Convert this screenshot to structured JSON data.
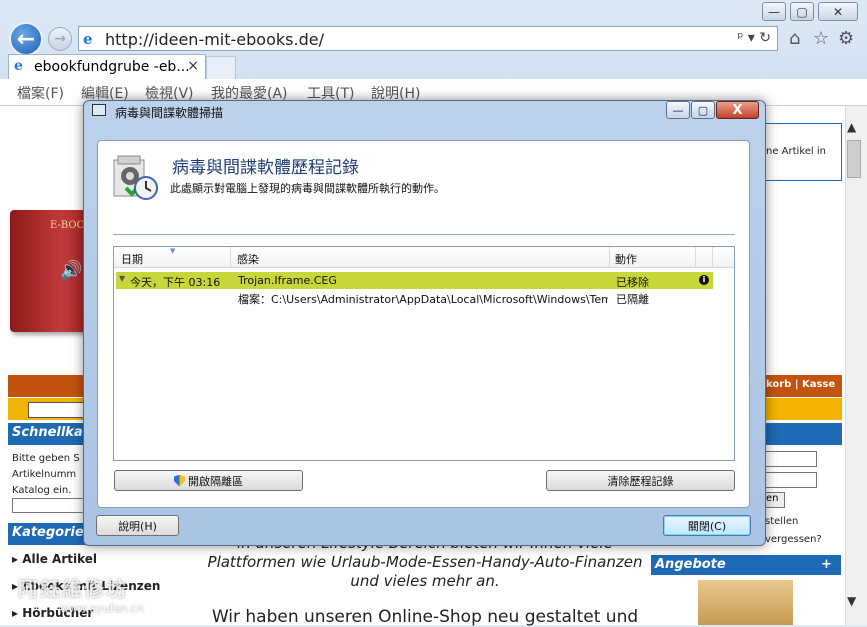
{
  "browser": {
    "url": "http://ideen-mit-ebooks.de/",
    "tab_title": "ebookfundgrube -eb...",
    "tab_close": "×",
    "menu": [
      "檔案(F)",
      "編輯(E)",
      "檢視(V)",
      "我的最愛(A)",
      "工具(T)",
      "說明(H)"
    ],
    "address_tools": "ᵖ ▾ ↻"
  },
  "page": {
    "schnellkauf": "Schnellkau",
    "schnell_text": [
      "Bitte geben S",
      "Artikelnumm",
      "Katalog ein."
    ],
    "kategorien": "Kategorien",
    "categories": [
      "Alle Artikel",
      "Ebooks mit Lizenzen",
      "Hörbücher"
    ],
    "right_top_text": "ne Artikel in",
    "right_orange": "korb | Kasse",
    "right_btn": "en",
    "right_stellen": "stellen",
    "right_vergessen": "vergessen?",
    "angebote": "Angebote",
    "angebote_plus": "+",
    "center_line1": "in unseren Lifestyle Bereich bieten wir Ihnen viele",
    "center_line2": "Plattformen wie Urlaub-Mode-Essen-Handy-Auto-Finanzen",
    "center_line3": "und vieles mehr an.",
    "center_line4": "Wir haben unseren Online-Shop neu gestaltet und",
    "book_title": "E-BOOK",
    "watermark": "阿鈺維修坊",
    "watermark_url": "www.ayufan.cn"
  },
  "dialog": {
    "title": "病毒與間諜軟體掃描",
    "heading": "病毒與間諜軟體歷程記錄",
    "description": "此處顯示對電腦上發現的病毒與間諜軟體所執行的動作。",
    "columns": {
      "date": "日期",
      "infection": "感染",
      "action": "動作"
    },
    "rows": [
      {
        "date": "今天，下午 03:16",
        "infection": "Trojan.Iframe.CEG",
        "action": "已移除"
      },
      {
        "date": "",
        "infection": "檔案：C:\\Users\\Administrator\\AppData\\Local\\Microsoft\\Windows\\Tempor...",
        "action": "已隔離"
      }
    ],
    "open_quarantine": "開啟隔離區",
    "clear_history": "清除歷程記錄",
    "help": "說明(H)",
    "close": "關閉(C)",
    "btn_min": "—",
    "btn_max": "▢",
    "btn_close": "X"
  },
  "colors": {
    "selected_row": "#c8d63a",
    "accent_blue": "#1f6ab5",
    "orange": "#c2540f",
    "yellow": "#f2b400"
  }
}
